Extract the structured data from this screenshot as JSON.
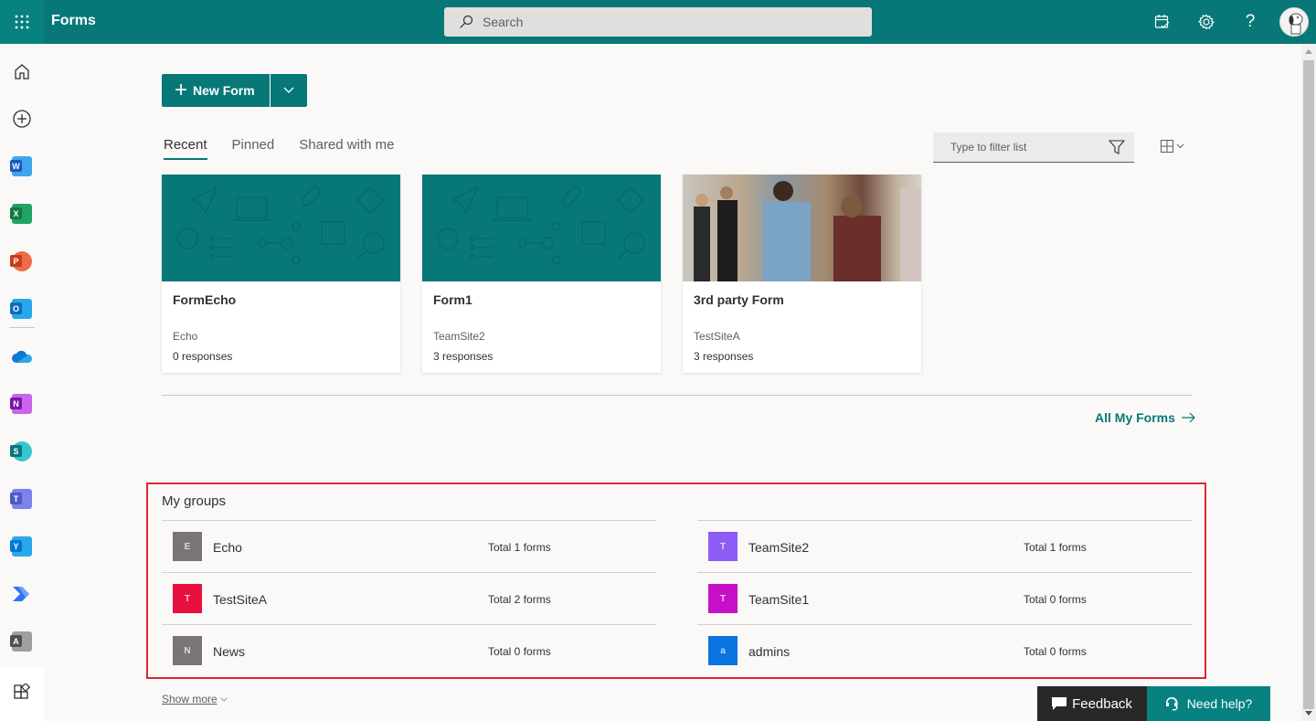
{
  "header": {
    "app_name": "Forms",
    "search_placeholder": "Search",
    "icons": [
      "app-launcher-icon",
      "my-tasks-icon",
      "settings-icon",
      "help-icon",
      "profile-avatar"
    ],
    "brand_color": "#077877"
  },
  "rail": {
    "items": [
      {
        "name": "Home",
        "icon": "home-icon"
      },
      {
        "name": "Create",
        "icon": "add-circle-icon"
      },
      {
        "name": "Word",
        "icon": "word-icon",
        "letter": "W",
        "color": "#185abd"
      },
      {
        "name": "Excel",
        "icon": "excel-icon",
        "letter": "X",
        "color": "#107c41"
      },
      {
        "name": "PowerPoint",
        "icon": "powerpoint-icon",
        "letter": "P",
        "color": "#c43e1c"
      },
      {
        "name": "Outlook",
        "icon": "outlook-icon",
        "letter": "O",
        "color": "#0f6cbd"
      },
      {
        "name": "OneDrive",
        "icon": "onedrive-icon",
        "color": "#0364b8"
      },
      {
        "name": "OneNote",
        "icon": "onenote-icon",
        "letter": "N",
        "color": "#7719aa"
      },
      {
        "name": "SharePoint",
        "icon": "sharepoint-icon",
        "letter": "S",
        "color": "#03787c"
      },
      {
        "name": "Teams",
        "icon": "teams-icon",
        "letter": "T",
        "color": "#5059c9"
      },
      {
        "name": "Yammer",
        "icon": "yammer-icon",
        "letter": "Y",
        "color": "#0078d4"
      },
      {
        "name": "Power Automate",
        "icon": "power-automate-icon",
        "color": "#0066ff"
      },
      {
        "name": "Admin",
        "icon": "admin-icon",
        "letter": "A",
        "color": "#505050"
      },
      {
        "name": "All apps",
        "icon": "all-apps-icon"
      }
    ]
  },
  "toolbar": {
    "new_form_label": "New Form",
    "tabs": [
      {
        "label": "Recent",
        "active": true
      },
      {
        "label": "Pinned",
        "active": false
      },
      {
        "label": "Shared with me",
        "active": false
      }
    ],
    "filter_placeholder": "Type to filter list"
  },
  "cards": [
    {
      "title": "FormEcho",
      "group": "Echo",
      "responses": "0 responses",
      "cover": "pattern"
    },
    {
      "title": "Form1",
      "group": "TeamSite2",
      "responses": "3 responses",
      "cover": "pattern"
    },
    {
      "title": "3rd party Form",
      "group": "TestSiteA",
      "responses": "3 responses",
      "cover": "photo"
    }
  ],
  "all_forms_label": "All My Forms",
  "groups": {
    "title": "My groups",
    "left": [
      {
        "initial": "E",
        "name": "Echo",
        "count": "Total 1 forms",
        "color": "#7a7574"
      },
      {
        "initial": "T",
        "name": "TestSiteA",
        "count": "Total 2 forms",
        "color": "#e8103e"
      },
      {
        "initial": "N",
        "name": "News",
        "count": "Total 0 forms",
        "color": "#7a7574"
      }
    ],
    "right": [
      {
        "initial": "T",
        "name": "TeamSite2",
        "count": "Total 1 forms",
        "color": "#8b5cf6"
      },
      {
        "initial": "T",
        "name": "TeamSite1",
        "count": "Total 0 forms",
        "color": "#c80fc8"
      },
      {
        "initial": "a",
        "name": "admins",
        "count": "Total 0 forms",
        "color": "#0b74e0"
      }
    ],
    "highlight_color": "#d92a35"
  },
  "show_more_label": "Show more",
  "footer": {
    "feedback_label": "Feedback",
    "help_label": "Need help?"
  }
}
